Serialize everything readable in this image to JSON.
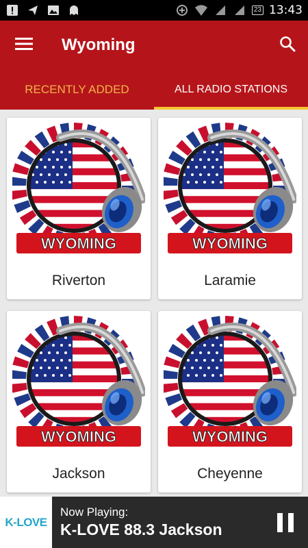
{
  "status_bar": {
    "time": "13:43",
    "battery": "23",
    "icons": [
      "notification-alert-icon",
      "send-icon",
      "image-icon",
      "ghost-icon",
      "data-saver-icon",
      "wifi-icon",
      "signal-icon",
      "signal-2-icon",
      "battery-icon"
    ]
  },
  "app_bar": {
    "title": "Wyoming",
    "menu_icon": "hamburger-menu-icon",
    "search_icon": "search-icon"
  },
  "tabs": [
    {
      "label": "RECENTLY ADDED",
      "selected": false
    },
    {
      "label": "ALL RADIO STATIONS",
      "selected": true
    }
  ],
  "stations": [
    {
      "name": "Riverton",
      "logo_text": "WYOMING"
    },
    {
      "name": "Laramie",
      "logo_text": "WYOMING"
    },
    {
      "name": "Jackson",
      "logo_text": "WYOMING"
    },
    {
      "name": "Cheyenne",
      "logo_text": "WYOMING"
    }
  ],
  "now_playing": {
    "label": "Now Playing:",
    "station": "K-LOVE 88.3 Jackson",
    "logo_text": "K-LOVE",
    "control_icon": "pause-icon"
  },
  "colors": {
    "app_bar": "#b5151a",
    "tab_indicator": "#f5c531",
    "tab_inactive_text": "#f2b34a",
    "now_playing_bg": "#2a2a2a",
    "klove_blue": "#23a6c9"
  }
}
